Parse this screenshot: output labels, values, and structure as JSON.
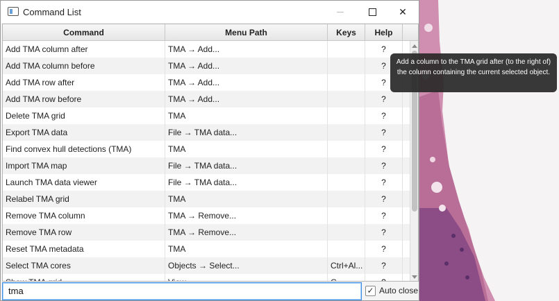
{
  "window": {
    "title": "Command List",
    "controls": {
      "minimize": "—",
      "maximize": "☐",
      "close": "✕"
    }
  },
  "table": {
    "columns": [
      "Command",
      "Menu Path",
      "Keys",
      "Help"
    ],
    "rows": [
      {
        "command": "Add TMA column after",
        "path": "TMA → Add...",
        "keys": "",
        "help": "?"
      },
      {
        "command": "Add TMA column before",
        "path": "TMA → Add...",
        "keys": "",
        "help": "?"
      },
      {
        "command": "Add TMA row after",
        "path": "TMA → Add...",
        "keys": "",
        "help": "?"
      },
      {
        "command": "Add TMA row before",
        "path": "TMA → Add...",
        "keys": "",
        "help": "?"
      },
      {
        "command": "Delete TMA grid",
        "path": "TMA",
        "keys": "",
        "help": "?"
      },
      {
        "command": "Export TMA data",
        "path": "File → TMA data...",
        "keys": "",
        "help": "?"
      },
      {
        "command": "Find convex hull detections (TMA)",
        "path": "TMA",
        "keys": "",
        "help": "?"
      },
      {
        "command": "Import TMA map",
        "path": "File → TMA data...",
        "keys": "",
        "help": "?"
      },
      {
        "command": "Launch TMA data viewer",
        "path": "File → TMA data...",
        "keys": "",
        "help": "?"
      },
      {
        "command": "Relabel TMA grid",
        "path": "TMA",
        "keys": "",
        "help": "?"
      },
      {
        "command": "Remove TMA column",
        "path": "TMA → Remove...",
        "keys": "",
        "help": "?"
      },
      {
        "command": "Remove TMA row",
        "path": "TMA → Remove...",
        "keys": "",
        "help": "?"
      },
      {
        "command": "Reset TMA metadata",
        "path": "TMA",
        "keys": "",
        "help": "?"
      },
      {
        "command": "Select TMA cores",
        "path": "Objects → Select...",
        "keys": "Ctrl+Al...",
        "help": "?"
      },
      {
        "command": "Show TMA grid",
        "path": "View",
        "keys": "G",
        "help": "?"
      }
    ]
  },
  "search": {
    "value": "tma"
  },
  "auto_close": {
    "label": "Auto close",
    "checked": true,
    "mark": "✓"
  },
  "tooltip": {
    "text": "Add a column to the TMA grid after (to the right of) the column containing the current selected object."
  },
  "colors": {
    "tissue_pink": "#c77fa6",
    "tissue_purple": "#6b3b7d",
    "accent_focus": "#3a8ee6"
  }
}
